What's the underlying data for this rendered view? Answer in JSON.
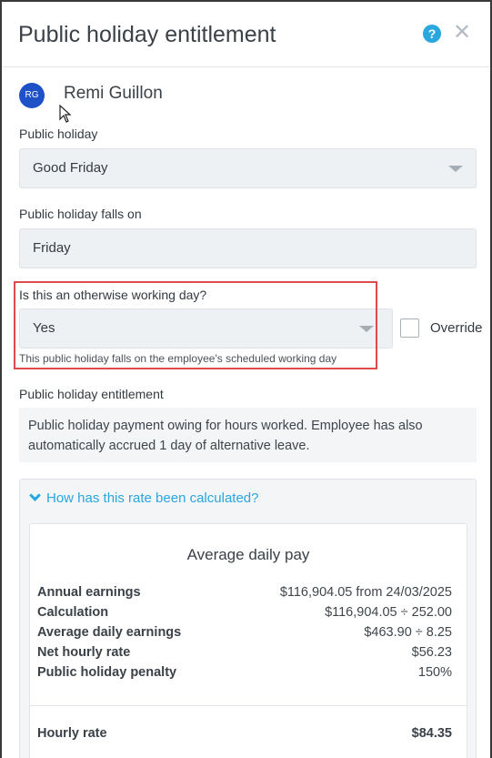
{
  "dialog": {
    "title": "Public holiday entitlement"
  },
  "employee": {
    "initials": "RG",
    "name": "Remi Guillon"
  },
  "public_holiday": {
    "label": "Public holiday",
    "value": "Good Friday"
  },
  "falls_on": {
    "label": "Public holiday falls on",
    "value": "Friday"
  },
  "working_day": {
    "label": "Is this an otherwise working day?",
    "value": "Yes",
    "override_label": "Override",
    "override_checked": false,
    "hint": "This public holiday falls on the employee's scheduled working day"
  },
  "entitlement": {
    "label": "Public holiday entitlement",
    "text": "Public holiday payment owing for hours worked. Employee has also automatically accrued 1 day of alternative leave."
  },
  "calculation": {
    "toggle_label": "How has this rate been calculated?",
    "title": "Average daily pay",
    "rows": [
      {
        "label": "Annual earnings",
        "value": "$116,904.05 from 24/03/2025"
      },
      {
        "label": "Calculation",
        "value": "$116,904.05 ÷ 252.00"
      },
      {
        "label": "Average daily earnings",
        "value": "$463.90 ÷ 8.25"
      },
      {
        "label": "Net hourly rate",
        "value": "$56.23"
      },
      {
        "label": "Public holiday penalty",
        "value": "150%"
      }
    ],
    "hourly_rate": {
      "label": "Hourly rate",
      "value": "$84.35"
    }
  },
  "colors": {
    "accent": "#29a7de",
    "avatar": "#1e50c8",
    "highlight": "#e04a4a"
  }
}
